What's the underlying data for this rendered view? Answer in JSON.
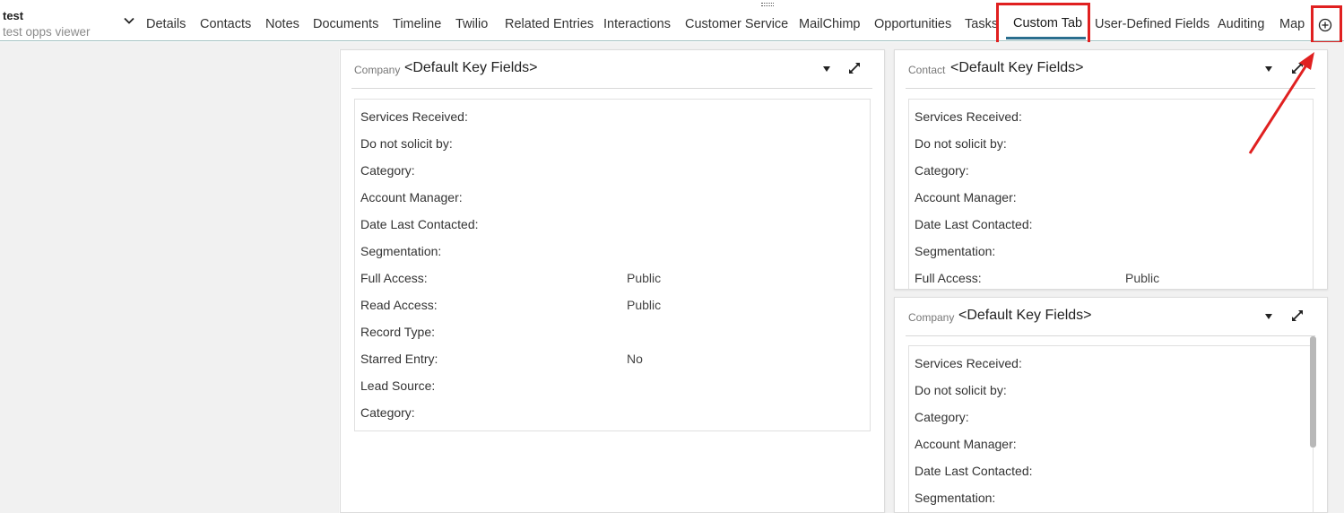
{
  "record": {
    "title": "test",
    "subtitle": "test opps viewer"
  },
  "tabs": [
    {
      "label": "Details"
    },
    {
      "label": "Contacts"
    },
    {
      "label": "Notes"
    },
    {
      "label": "Documents"
    },
    {
      "label": "Timeline"
    },
    {
      "label": "Twilio"
    },
    {
      "label": "Related Entries"
    },
    {
      "label": "Interactions"
    },
    {
      "label": "Customer Service"
    },
    {
      "label": "MailChimp"
    },
    {
      "label": "Opportunities"
    },
    {
      "label": "Tasks"
    },
    {
      "label": "Custom Tab",
      "active": true
    },
    {
      "label": "User-Defined Fields"
    },
    {
      "label": "Auditing"
    },
    {
      "label": "Map"
    }
  ],
  "icons": {
    "dropdown": "chevron-down-icon",
    "add_tab": "plus-circle-icon",
    "expand": "expand-icon",
    "caret": "caret-down-icon"
  },
  "colors": {
    "highlight": "#e02020",
    "active_tab_underline": "#2a6e8e"
  },
  "panels": {
    "left": {
      "label": "Company",
      "title": "<Default Key Fields>",
      "fields": [
        {
          "name": "Services Received:",
          "value": ""
        },
        {
          "name": "Do not solicit by:",
          "value": ""
        },
        {
          "name": "Category:",
          "value": ""
        },
        {
          "name": "Account Manager:",
          "value": ""
        },
        {
          "name": "Date Last Contacted:",
          "value": ""
        },
        {
          "name": "Segmentation:",
          "value": ""
        },
        {
          "name": "Full Access:",
          "value": "Public"
        },
        {
          "name": "Read Access:",
          "value": "Public"
        },
        {
          "name": "Record Type:",
          "value": ""
        },
        {
          "name": "Starred Entry:",
          "value": "No"
        },
        {
          "name": "Lead Source:",
          "value": ""
        },
        {
          "name": "Category:",
          "value": ""
        }
      ]
    },
    "right_top": {
      "label": "Contact",
      "title": "<Default Key Fields>",
      "fields": [
        {
          "name": "Services Received:",
          "value": ""
        },
        {
          "name": "Do not solicit by:",
          "value": ""
        },
        {
          "name": "Category:",
          "value": ""
        },
        {
          "name": "Account Manager:",
          "value": ""
        },
        {
          "name": "Date Last Contacted:",
          "value": ""
        },
        {
          "name": "Segmentation:",
          "value": ""
        },
        {
          "name": "Full Access:",
          "value": "Public"
        }
      ]
    },
    "right_bottom": {
      "label": "Company",
      "title": "<Default Key Fields>",
      "fields": [
        {
          "name": "Services Received:",
          "value": ""
        },
        {
          "name": "Do not solicit by:",
          "value": ""
        },
        {
          "name": "Category:",
          "value": ""
        },
        {
          "name": "Account Manager:",
          "value": ""
        },
        {
          "name": "Date Last Contacted:",
          "value": ""
        },
        {
          "name": "Segmentation:",
          "value": ""
        }
      ]
    }
  }
}
